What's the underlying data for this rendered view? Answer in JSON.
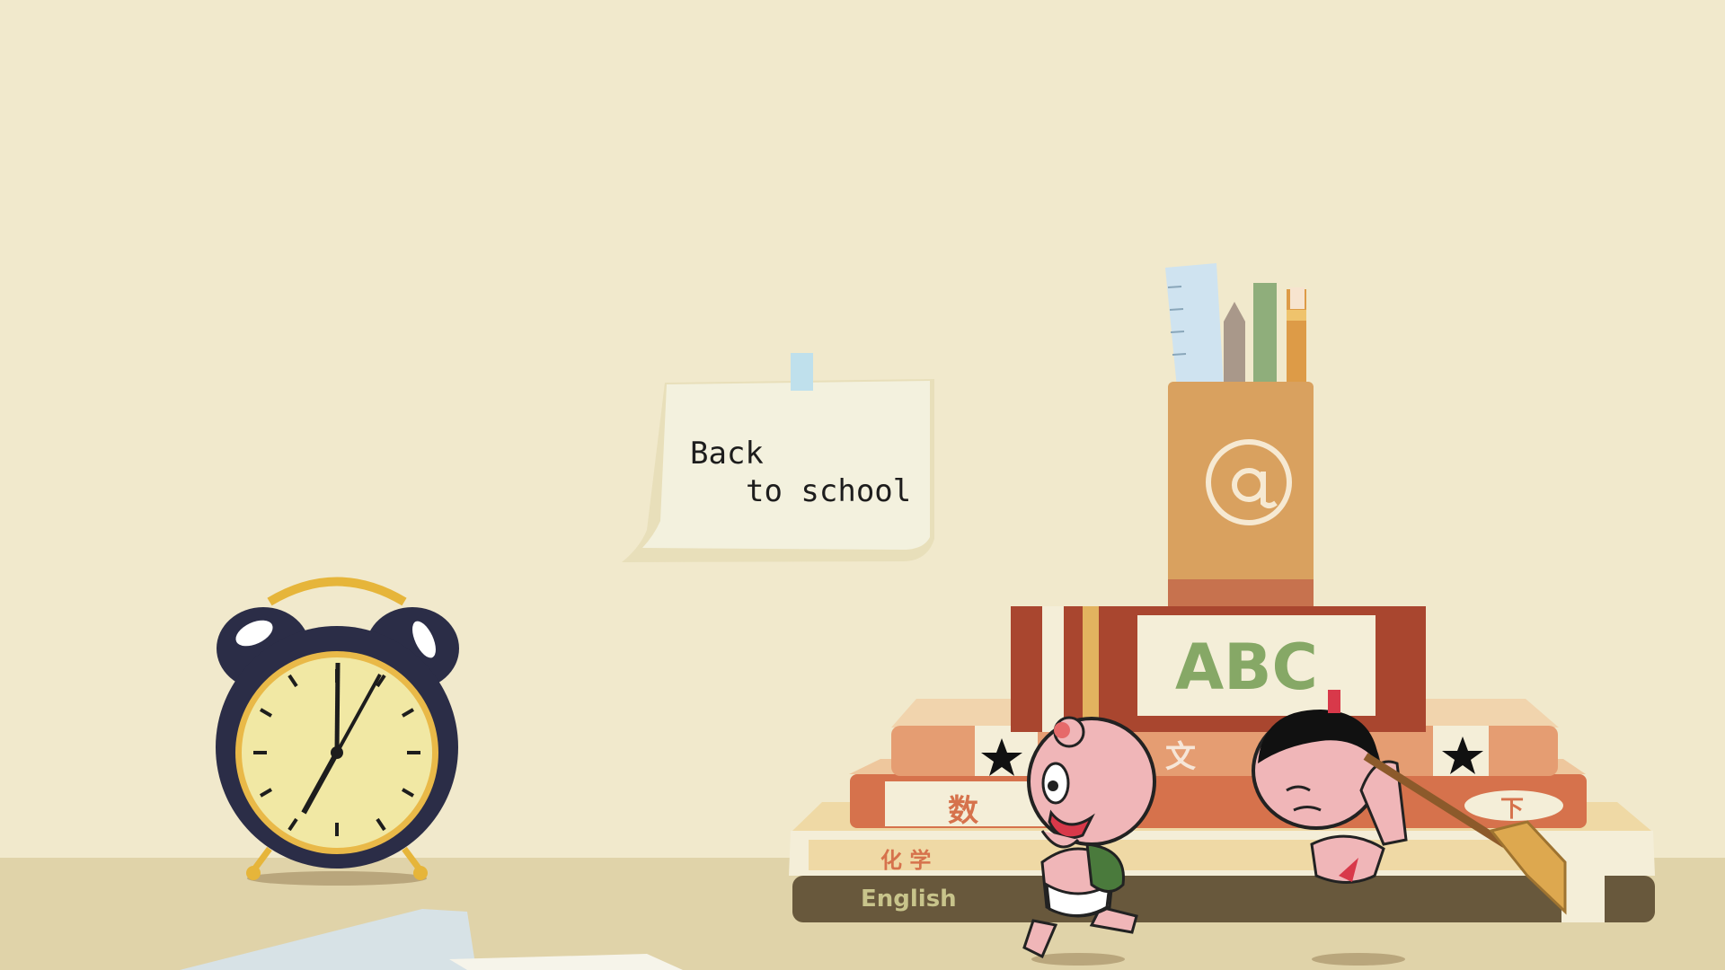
{
  "note": {
    "line1": "Back",
    "line2": "to school"
  },
  "books": {
    "top_label": "ABC",
    "chinese": "文",
    "math": "数",
    "chemistry": "化    学",
    "english": "English",
    "extra": "下"
  },
  "colors": {
    "wall": "#f1e9cc",
    "desk": "#e0d3a9",
    "clock_body": "#2b2d47",
    "clock_face": "#f1e8a4",
    "brand_orange": "#d9a15f"
  },
  "icons": [
    "alarm-clock-icon",
    "pencil-cup-icon",
    "ruler-icon",
    "pencil-icon",
    "broom-icon",
    "star-icon"
  ]
}
